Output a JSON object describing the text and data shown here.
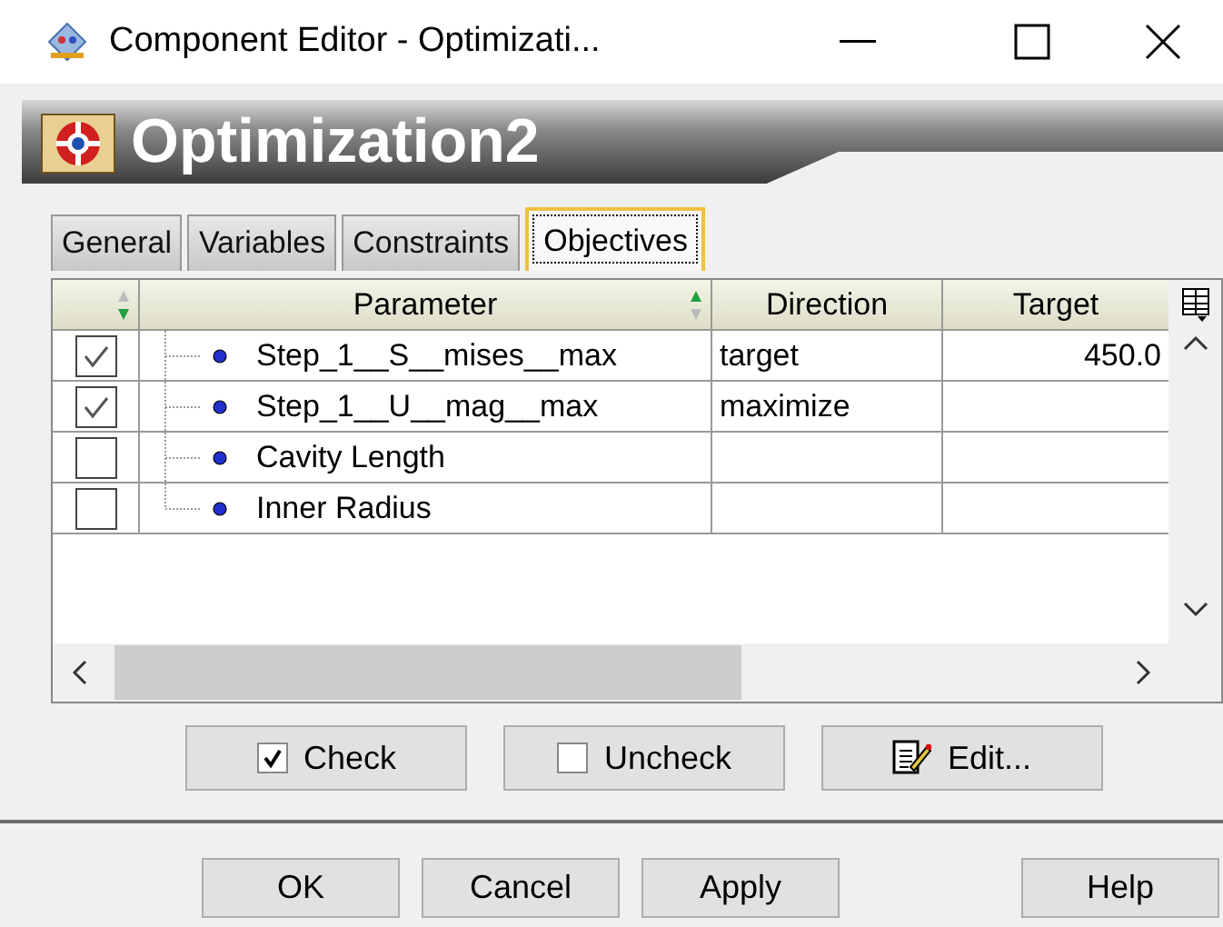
{
  "window": {
    "title": "Component Editor - Optimizati..."
  },
  "banner": {
    "title": "Optimization2"
  },
  "tabs": [
    {
      "label": "General",
      "selected": false
    },
    {
      "label": "Variables",
      "selected": false
    },
    {
      "label": "Constraints",
      "selected": false
    },
    {
      "label": "Objectives",
      "selected": true
    }
  ],
  "table": {
    "columns": [
      "Parameter",
      "Direction",
      "Target"
    ],
    "rows": [
      {
        "checked": true,
        "parameter": "Step_1__S__mises__max",
        "direction": "target",
        "target": "450.0"
      },
      {
        "checked": true,
        "parameter": "Step_1__U__mag__max",
        "direction": "maximize",
        "target": ""
      },
      {
        "checked": false,
        "parameter": "Cavity Length",
        "direction": "",
        "target": ""
      },
      {
        "checked": false,
        "parameter": "Inner Radius",
        "direction": "",
        "target": ""
      }
    ]
  },
  "actions": [
    {
      "kind": "check",
      "label": "Check"
    },
    {
      "kind": "uncheck",
      "label": "Uncheck"
    },
    {
      "kind": "edit",
      "label": "Edit..."
    }
  ],
  "buttons": [
    {
      "label": "OK"
    },
    {
      "label": "Cancel"
    },
    {
      "label": "Apply"
    },
    {
      "label": "Help"
    }
  ]
}
